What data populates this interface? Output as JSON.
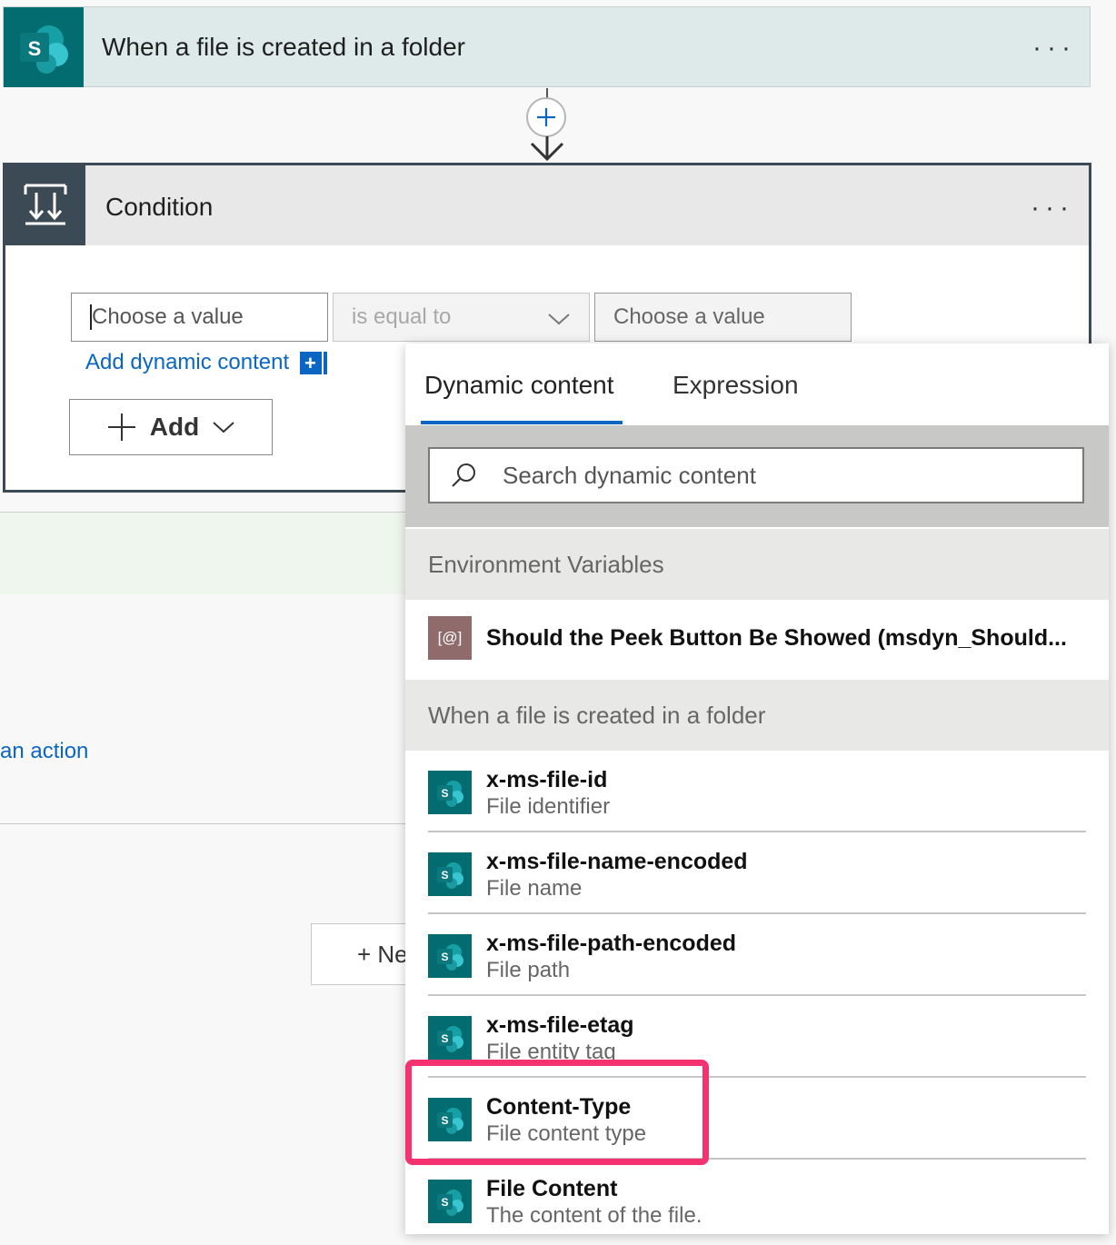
{
  "trigger": {
    "title": "When a file is created in a folder",
    "more": "···"
  },
  "condition": {
    "title": "Condition",
    "more": "···",
    "left_placeholder": "Choose a value",
    "operator": "is equal to",
    "right_placeholder": "Choose a value",
    "add_dynamic_link": "Add dynamic content",
    "add_button": "Add"
  },
  "background": {
    "an_action": "an action",
    "new_step": "+ Ne"
  },
  "panel": {
    "tabs": [
      "Dynamic content",
      "Expression"
    ],
    "search_placeholder": "Search dynamic content",
    "env_section": "Environment Variables",
    "env_item": {
      "icon": "[@]",
      "title": "Should the Peek Button Be Showed (msdyn_Should..."
    },
    "trigger_section": "When a file is created in a folder",
    "items": [
      {
        "title": "x-ms-file-id",
        "subtitle": "File identifier"
      },
      {
        "title": "x-ms-file-name-encoded",
        "subtitle": "File name"
      },
      {
        "title": "x-ms-file-path-encoded",
        "subtitle": "File path"
      },
      {
        "title": "x-ms-file-etag",
        "subtitle": "File entity tag"
      },
      {
        "title": "Content-Type",
        "subtitle": "File content type"
      },
      {
        "title": "File Content",
        "subtitle": "The content of the file."
      }
    ]
  },
  "colors": {
    "sharepoint_teal": "#036c70",
    "accent_blue": "#0a66c2",
    "highlight": "#f5316f"
  }
}
